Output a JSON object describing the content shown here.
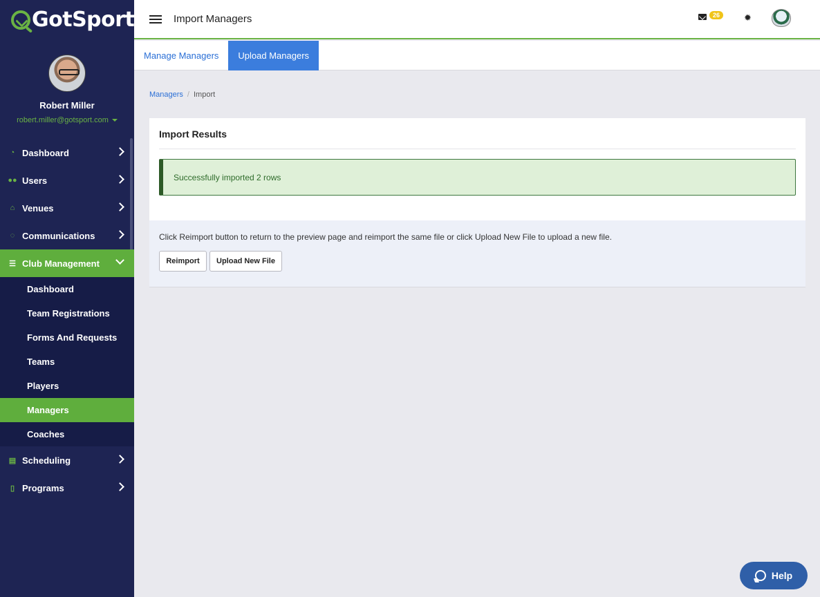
{
  "app": {
    "brand": "GotSport",
    "page_title": "Import Managers"
  },
  "user": {
    "name": "Robert Miller",
    "email": "robert.miller@gotsport.com"
  },
  "sidebar": {
    "items": [
      {
        "label": "Dashboard",
        "icon": "dashboard-icon"
      },
      {
        "label": "Users",
        "icon": "users-icon"
      },
      {
        "label": "Venues",
        "icon": "home-icon"
      },
      {
        "label": "Communications",
        "icon": "chat-icon"
      },
      {
        "label": "Club Management",
        "icon": "list-icon",
        "expanded": true
      },
      {
        "label": "Scheduling",
        "icon": "calendar-icon"
      },
      {
        "label": "Programs",
        "icon": "document-icon"
      }
    ],
    "club_management_sub": [
      {
        "label": "Dashboard"
      },
      {
        "label": "Team Registrations"
      },
      {
        "label": "Forms And Requests"
      },
      {
        "label": "Teams"
      },
      {
        "label": "Players"
      },
      {
        "label": "Managers",
        "active": true
      },
      {
        "label": "Coaches"
      }
    ]
  },
  "topbar": {
    "mail_count": "26"
  },
  "tabs": [
    {
      "label": "Manage Managers",
      "active": false
    },
    {
      "label": "Upload Managers",
      "active": true
    }
  ],
  "breadcrumb": {
    "parent": "Managers",
    "separator": "/",
    "current": "Import"
  },
  "card": {
    "title": "Import Results",
    "alert": "Successfully imported 2 rows",
    "instructions": "Click Reimport button to return to the preview page and reimport the same file or click Upload New File to upload a new file.",
    "reimport_label": "Reimport",
    "upload_label": "Upload New File"
  },
  "help": {
    "label": "Help"
  },
  "colors": {
    "sidebar_bg": "#1e2453",
    "accent_green": "#5fae3d",
    "tab_active": "#3b7ddd",
    "link_blue": "#2a6fd6"
  }
}
